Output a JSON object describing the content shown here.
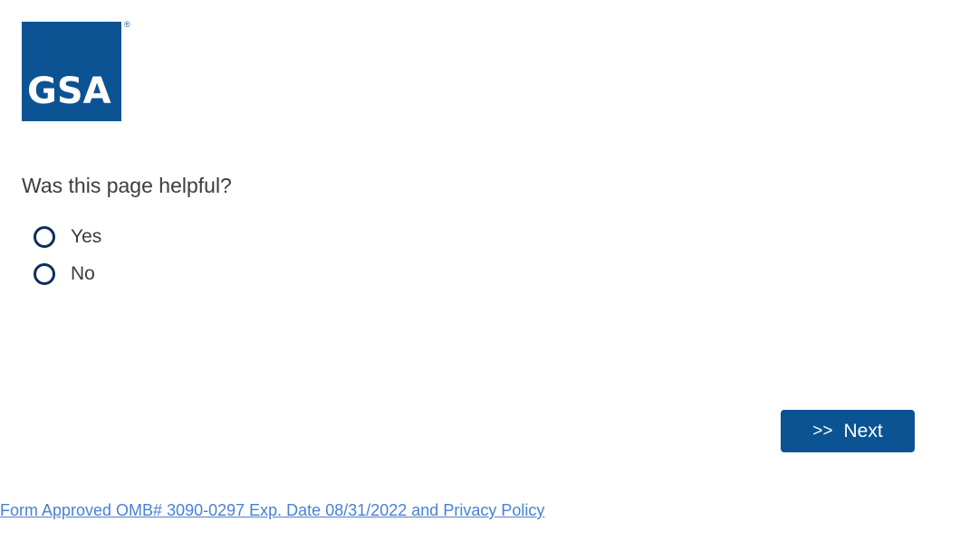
{
  "logo": {
    "text": "GSA",
    "registered_mark": "®",
    "color": "#0b5393"
  },
  "survey": {
    "question": "Was this page helpful?",
    "options": [
      {
        "label": "Yes",
        "selected": false
      },
      {
        "label": "No",
        "selected": false
      }
    ]
  },
  "navigation": {
    "next_arrows": ">>",
    "next_label": "Next",
    "button_color": "#0b5393"
  },
  "footer": {
    "link_text": "Form Approved OMB# 3090-0297 Exp. Date 08/31/2022 and Privacy Policy",
    "link_color": "#4a7fd4"
  }
}
